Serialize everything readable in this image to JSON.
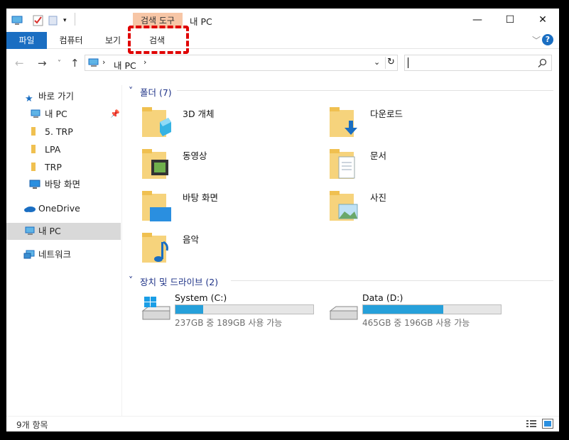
{
  "window": {
    "title": "내 PC",
    "contextual_tab_group": "검색 도구",
    "controls": {
      "minimize": "—",
      "maximize": "☐",
      "close": "✕"
    }
  },
  "ribbon": {
    "tabs": [
      {
        "label": "파일",
        "active": true
      },
      {
        "label": "컴퓨터",
        "active": false
      },
      {
        "label": "보기",
        "active": false
      },
      {
        "label": "검색",
        "active": false,
        "highlighted": true
      }
    ],
    "help": "?"
  },
  "address": {
    "path": "내 PC",
    "search_placeholder": ""
  },
  "nav": {
    "items": [
      {
        "label": "바로 가기",
        "icon": "star-icon",
        "pinned": false
      },
      {
        "label": "내 PC",
        "icon": "pc-icon",
        "pinned": true
      },
      {
        "label": "5. TRP",
        "icon": "folder-icon",
        "pinned": false
      },
      {
        "label": "LPA",
        "icon": "folder-icon",
        "pinned": false
      },
      {
        "label": "TRP",
        "icon": "folder-icon",
        "pinned": false
      },
      {
        "label": "바탕 화면",
        "icon": "desktop-icon",
        "pinned": false
      },
      {
        "label": "OneDrive",
        "icon": "cloud-icon",
        "pinned": false
      },
      {
        "label": "내 PC",
        "icon": "pc-icon",
        "selected": true
      },
      {
        "label": "네트워크",
        "icon": "network-icon",
        "pinned": false
      }
    ]
  },
  "folders": {
    "header": "폴더 (7)",
    "items": [
      {
        "name": "3D 개체",
        "icon": "3d-objects-icon"
      },
      {
        "name": "다운로드",
        "icon": "downloads-icon"
      },
      {
        "name": "동영상",
        "icon": "videos-icon"
      },
      {
        "name": "문서",
        "icon": "documents-icon"
      },
      {
        "name": "바탕 화면",
        "icon": "desktop-folder-icon"
      },
      {
        "name": "사진",
        "icon": "pictures-icon"
      },
      {
        "name": "음악",
        "icon": "music-icon"
      }
    ]
  },
  "drives": {
    "header": "장치 및 드라이브 (2)",
    "items": [
      {
        "name": "System (C:)",
        "caption": "237GB 중 189GB 사용 가능",
        "used_fraction": 0.2
      },
      {
        "name": "Data (D:)",
        "caption": "465GB 중 196GB 사용 가능",
        "used_fraction": 0.58
      }
    ]
  },
  "status": {
    "count": "9개 항목"
  },
  "colors": {
    "accent": "#1a6ec2",
    "drive_fill": "#26a0da",
    "highlight": "#e00000",
    "context_tab": "#f7c6a6"
  }
}
